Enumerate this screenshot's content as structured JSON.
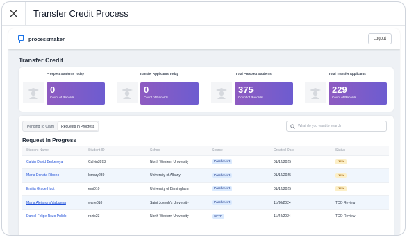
{
  "window": {
    "title": "Transfer Credit Process"
  },
  "header": {
    "logo_text": "processmaker",
    "logout_label": "Logout"
  },
  "page": {
    "title": "Transfer Credit"
  },
  "stats": [
    {
      "label": "Prospect Students Today",
      "value": "0",
      "sub": "Count of Records"
    },
    {
      "label": "Transfer Applicants Today",
      "value": "0",
      "sub": "Count of Records"
    },
    {
      "label": "Total Prospect Students",
      "value": "375",
      "sub": "Count of Records"
    },
    {
      "label": "Total Transfer Applicants",
      "value": "229",
      "sub": "Count of Records"
    }
  ],
  "tabs": [
    {
      "label": "Pending To Claim",
      "active": false
    },
    {
      "label": "Requests In Progress",
      "active": true
    }
  ],
  "search": {
    "placeholder": "What do you want to search"
  },
  "section": {
    "title": "Request In Progress"
  },
  "table": {
    "columns": [
      "Student Name",
      "Student ID",
      "School",
      "Source",
      "Created Date",
      "Status"
    ],
    "rows": [
      {
        "name": "Calvin David Berkeroya",
        "id": "Calvin3993",
        "school": "North Western University",
        "source": "Parchment",
        "date": "01/12/2025",
        "status": "New"
      },
      {
        "name": "Maria Donata Ribono",
        "id": "lomary289",
        "school": "University of Albany",
        "source": "Parchment",
        "date": "01/12/2025",
        "status": "New"
      },
      {
        "name": "Emilia Grace Huut",
        "id": "emi010",
        "school": "University of Birmingham",
        "source": "Parchment",
        "date": "01/12/2025",
        "status": "New"
      },
      {
        "name": "Maria Alejandra Valbuena",
        "id": "wane010",
        "school": "Saint Joseph's University",
        "source": "Parchment",
        "date": "11/30/2024",
        "status": "TCO Review"
      },
      {
        "name": "Daniel Felipe Rozo Pulido",
        "id": "rozio23",
        "school": "North Western University",
        "source": "SFTP",
        "date": "11/24/2024",
        "status": "TCO Review"
      }
    ]
  },
  "colors": {
    "accent_purple": "#8e5bc1",
    "accent_violet": "#6d5cd0",
    "link_blue": "#1d4ed8",
    "logo_blue": "#1a73e8"
  }
}
